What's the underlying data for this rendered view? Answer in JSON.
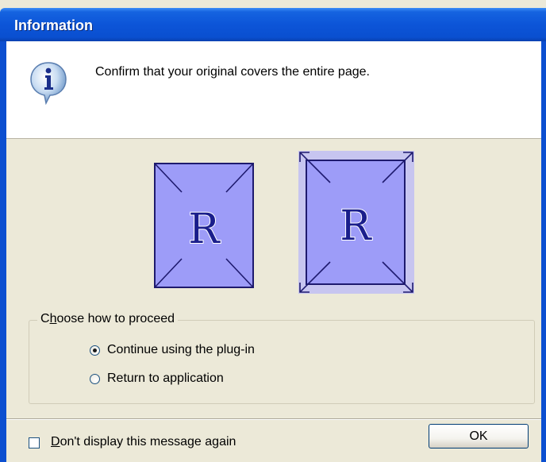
{
  "window": {
    "title": "Information"
  },
  "message": {
    "text": "Confirm that your original covers the entire page."
  },
  "illustration": {
    "glyph": "R",
    "page_color": "#9d9cf8",
    "shadow_color": "#c7c5f0"
  },
  "group": {
    "legend_prefix": "C",
    "legend_accel": "h",
    "legend_rest": "oose how to proceed",
    "options": [
      {
        "label": "Continue using the plug-in",
        "checked": true
      },
      {
        "label": "Return to application",
        "checked": false
      }
    ]
  },
  "footer": {
    "checkbox_accel": "D",
    "checkbox_rest": "on't display this message again",
    "checkbox_checked": false,
    "ok_label": "OK"
  },
  "colors": {
    "title_bar": "#0c55d8",
    "window_bg": "#ece9d8",
    "message_bg": "#ffffff"
  }
}
